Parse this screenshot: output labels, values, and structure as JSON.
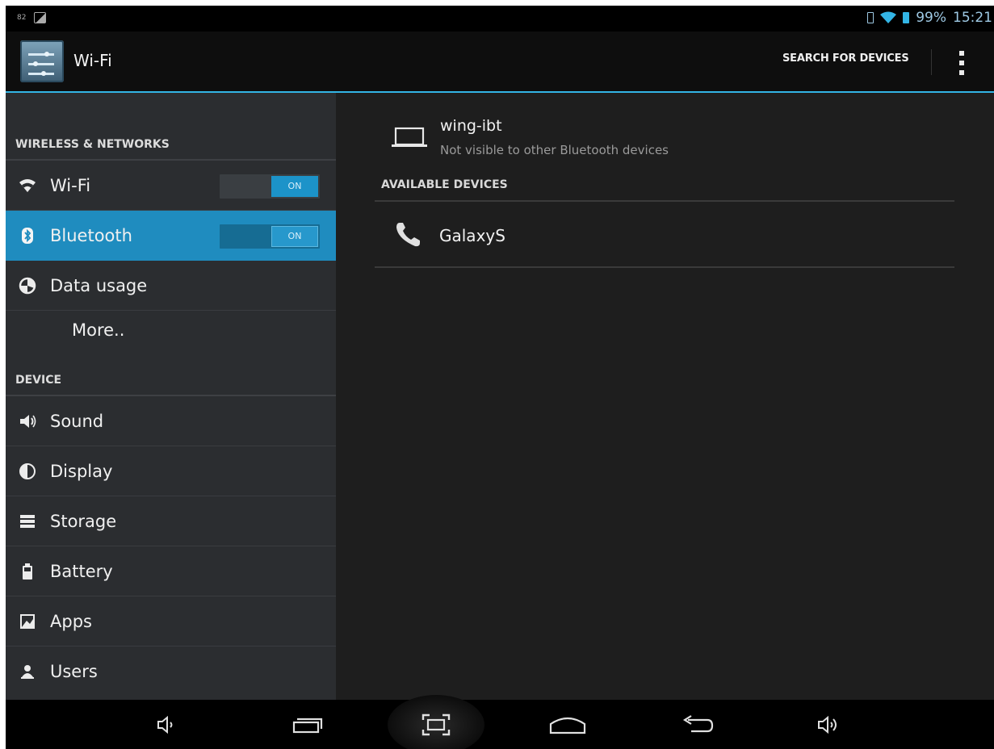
{
  "status_bar": {
    "left_mini_text": "82",
    "battery_percent": "99%",
    "time": "15:21"
  },
  "action_bar": {
    "title": "Wi-Fi",
    "search_label": "SEARCH FOR DEVICES",
    "icon": "settings-sliders-icon"
  },
  "settings": {
    "wireless_header": "WIRELESS & NETWORKS",
    "device_header": "DEVICE",
    "wireless_items": [
      {
        "label": "Wi-Fi",
        "icon": "wifi-icon",
        "toggle": "ON"
      },
      {
        "label": "Bluetooth",
        "icon": "bluetooth-icon",
        "toggle": "ON",
        "selected": true
      },
      {
        "label": "Data usage",
        "icon": "data-usage-icon"
      },
      {
        "label": "More..",
        "icon": ""
      }
    ],
    "device_items": [
      {
        "label": "Sound",
        "icon": "speaker-icon"
      },
      {
        "label": "Display",
        "icon": "display-icon"
      },
      {
        "label": "Storage",
        "icon": "storage-icon"
      },
      {
        "label": "Battery",
        "icon": "battery-icon"
      },
      {
        "label": "Apps",
        "icon": "apps-icon"
      },
      {
        "label": "Users",
        "icon": "users-icon"
      }
    ]
  },
  "bluetooth": {
    "this_device": {
      "name": "wing-ibt",
      "status": "Not visible to other Bluetooth devices",
      "icon": "laptop-icon"
    },
    "available_header": "AVAILABLE DEVICES",
    "available_devices": [
      {
        "name": "GalaxyS",
        "icon": "phone-icon"
      }
    ]
  },
  "nav_bar": {
    "buttons": [
      "volume-down-icon",
      "recent-apps-icon",
      "screenshot-icon",
      "home-icon",
      "back-icon",
      "volume-up-icon"
    ]
  },
  "colors": {
    "accent": "#33b5e5",
    "selected_row": "#1f8cbf",
    "left_pane_bg": "#2b2d30",
    "right_pane_bg": "#1e1e1e"
  }
}
